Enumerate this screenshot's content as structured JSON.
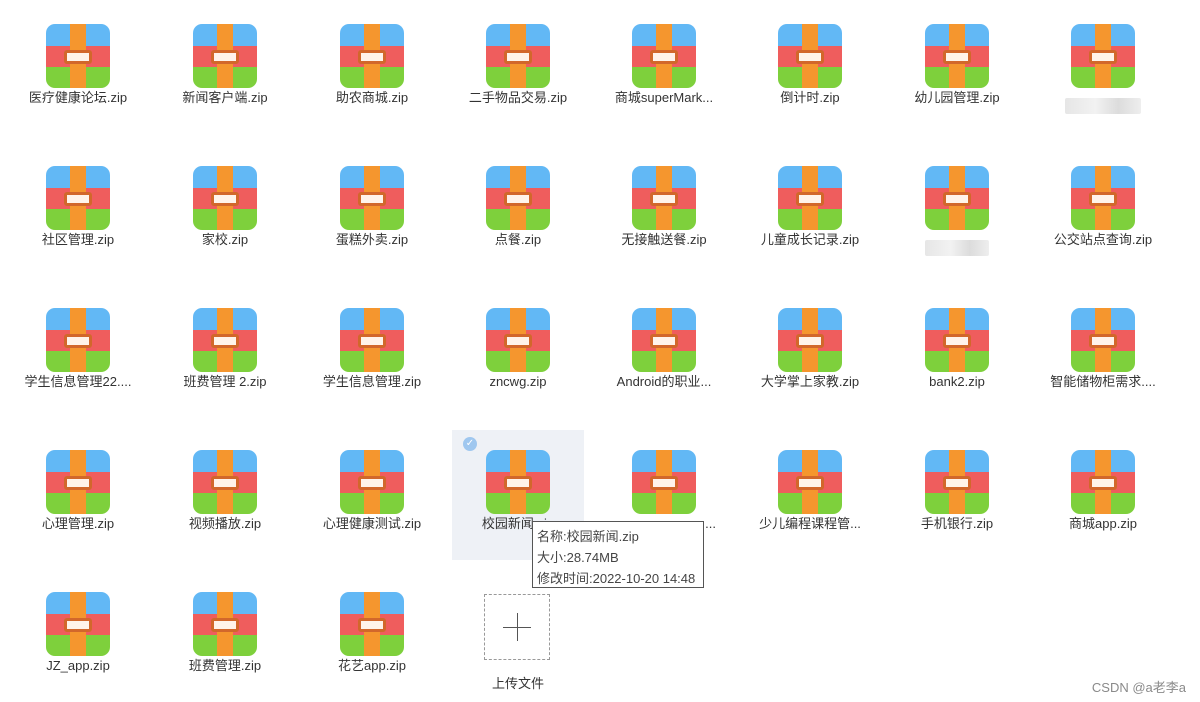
{
  "files": [
    {
      "name": "医疗健康论坛.zip"
    },
    {
      "name": "新闻客户端.zip"
    },
    {
      "name": "助农商城.zip"
    },
    {
      "name": "二手物品交易.zip"
    },
    {
      "name": "商城superMark..."
    },
    {
      "name": "倒计时.zip"
    },
    {
      "name": "幼儿园管理.zip"
    },
    {
      "name": "",
      "blurred": true
    },
    {
      "name": "社区管理.zip"
    },
    {
      "name": "家校.zip"
    },
    {
      "name": "蛋糕外卖.zip"
    },
    {
      "name": "点餐.zip"
    },
    {
      "name": "无接触送餐.zip"
    },
    {
      "name": "儿童成长记录.zip"
    },
    {
      "name": "",
      "blurred": true
    },
    {
      "name": "公交站点查询.zip"
    },
    {
      "name": "学生信息管理22...."
    },
    {
      "name": "班费管理 2.zip"
    },
    {
      "name": "学生信息管理.zip"
    },
    {
      "name": "zncwg.zip"
    },
    {
      "name": "Android的职业..."
    },
    {
      "name": "大学掌上家教.zip"
    },
    {
      "name": "bank2.zip"
    },
    {
      "name": "智能储物柜需求...."
    },
    {
      "name": "心理管理.zip"
    },
    {
      "name": "视频播放.zip"
    },
    {
      "name": "心理健康测试.zip"
    },
    {
      "name": "校园新闻.zip",
      "selected": true
    },
    {
      "name": "...",
      "hidden_by_tooltip": true
    },
    {
      "name": "少儿编程课程管..."
    },
    {
      "name": "手机银行.zip"
    },
    {
      "name": "商城app.zip"
    },
    {
      "name": "JZ_app.zip"
    },
    {
      "name": "班费管理.zip"
    },
    {
      "name": "花艺app.zip"
    }
  ],
  "icon": "zip-archive-icon",
  "colors": {
    "zip_top": "#62b8f5",
    "zip_middle": "#ef5d5d",
    "zip_bottom": "#7ed03c",
    "zip_strap": "#f5962e",
    "selected_bg": "#eef1f6"
  },
  "tooltip": {
    "name_line": "名称:校园新闻.zip",
    "size_line": "大小:28.74MB",
    "modified_line": "修改时间:2022-10-20 14:48"
  },
  "upload": {
    "label": "上传文件",
    "icon": "plus-icon"
  },
  "watermark": "CSDN @a老李a"
}
